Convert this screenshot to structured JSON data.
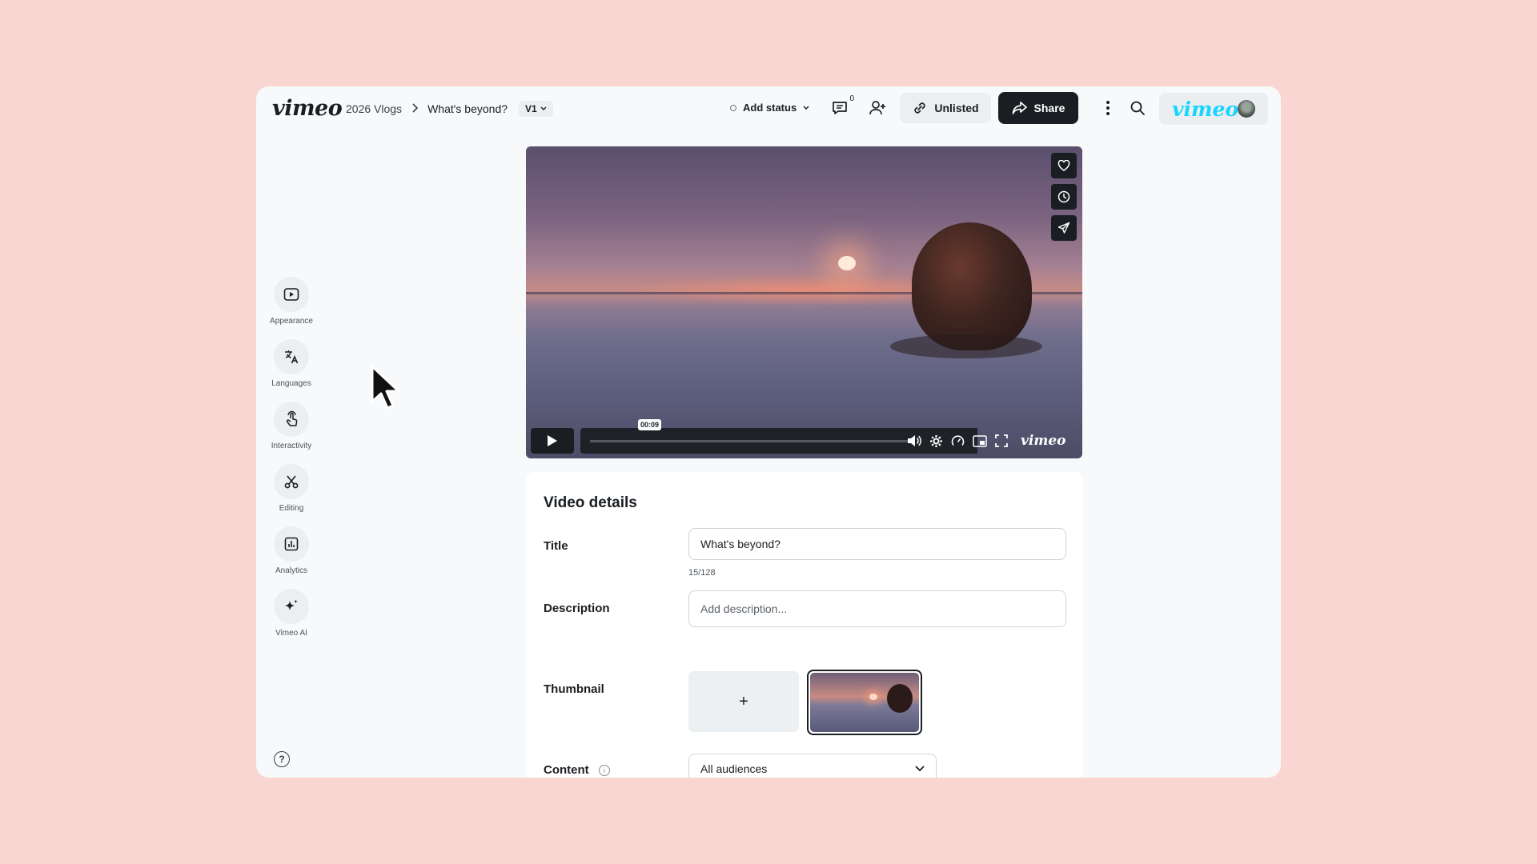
{
  "header": {
    "logo": "vimeo",
    "breadcrumb": [
      "2026 Vlogs",
      "What's beyond?"
    ],
    "version": "V1",
    "status_label": "Add status",
    "comments_count": "0",
    "unlisted_label": "Unlisted",
    "share_label": "Share",
    "account_logo": "vimeo"
  },
  "sidebar": {
    "items": [
      {
        "label": "Appearance",
        "icon": "play-square-icon"
      },
      {
        "label": "Languages",
        "icon": "translate-icon"
      },
      {
        "label": "Interactivity",
        "icon": "tap-icon"
      },
      {
        "label": "Editing",
        "icon": "scissors-icon"
      },
      {
        "label": "Analytics",
        "icon": "chart-icon"
      },
      {
        "label": "Vimeo AI",
        "icon": "sparkle-icon"
      }
    ],
    "help": "?"
  },
  "player": {
    "timestamp": "00:09",
    "brand": "vimeo"
  },
  "details": {
    "heading": "Video details",
    "title_label": "Title",
    "title_value": "What's beyond?",
    "title_counter": "15/128",
    "description_label": "Description",
    "description_placeholder": "Add description...",
    "thumbnail_label": "Thumbnail",
    "thumbnail_add": "+",
    "content_label": "Content",
    "content_value": "All audiences"
  },
  "colors": {
    "background": "#fad6d3",
    "brand_cyan": "#17d5ff",
    "dark": "#1a1e22"
  }
}
